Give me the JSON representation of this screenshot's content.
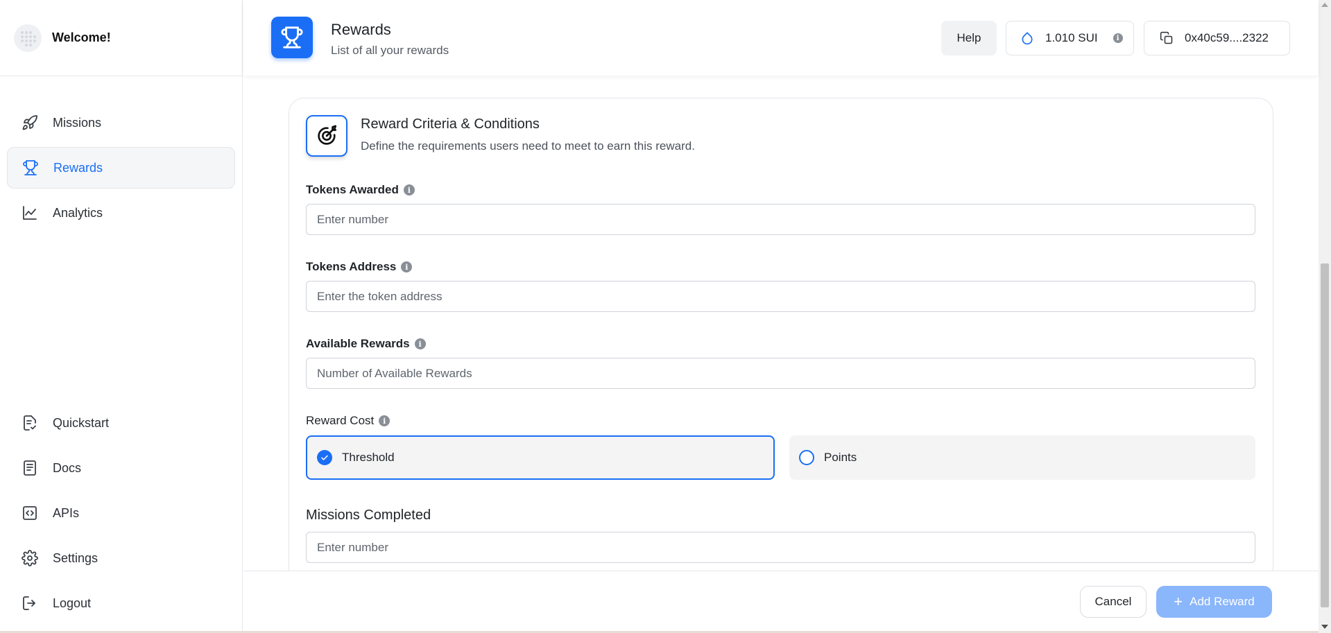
{
  "sidebar": {
    "brand": {
      "welcome": "Welcome!",
      "logo_icon": "grid-logo-icon"
    },
    "top_items": [
      {
        "label": "Missions",
        "icon": "rocket-icon",
        "active": false
      },
      {
        "label": "Rewards",
        "icon": "trophy-icon",
        "active": true
      },
      {
        "label": "Analytics",
        "icon": "chart-line-icon",
        "active": false
      }
    ],
    "bottom_items": [
      {
        "label": "Quickstart",
        "icon": "document-check-icon"
      },
      {
        "label": "Docs",
        "icon": "document-icon"
      },
      {
        "label": "APIs",
        "icon": "code-icon"
      },
      {
        "label": "Settings",
        "icon": "gear-icon"
      },
      {
        "label": "Logout",
        "icon": "logout-icon"
      }
    ]
  },
  "header": {
    "title": "Rewards",
    "subtitle": "List of all your rewards",
    "help_label": "Help",
    "balance": "1.010 SUI",
    "wallet_address": "0x40c59....2322"
  },
  "card": {
    "title": "Reward Criteria & Conditions",
    "description": "Define the requirements users need to meet to earn this reward."
  },
  "form": {
    "tokens_awarded": {
      "label": "Tokens Awarded",
      "placeholder": "Enter number",
      "value": ""
    },
    "tokens_address": {
      "label": "Tokens Address",
      "placeholder": "Enter the token address",
      "value": ""
    },
    "available_rewards": {
      "label": "Available Rewards",
      "placeholder": "Number of Available Rewards",
      "value": ""
    },
    "reward_cost": {
      "label": "Reward Cost",
      "options": [
        {
          "label": "Threshold",
          "selected": true
        },
        {
          "label": "Points",
          "selected": false
        }
      ]
    },
    "missions_completed": {
      "label": "Missions Completed",
      "placeholder": "Enter number",
      "value": ""
    }
  },
  "footer": {
    "cancel_label": "Cancel",
    "add_label": "Add Reward"
  },
  "colors": {
    "accent": "#1a6ef5",
    "add_button_disabled": "#8ab6fb"
  }
}
